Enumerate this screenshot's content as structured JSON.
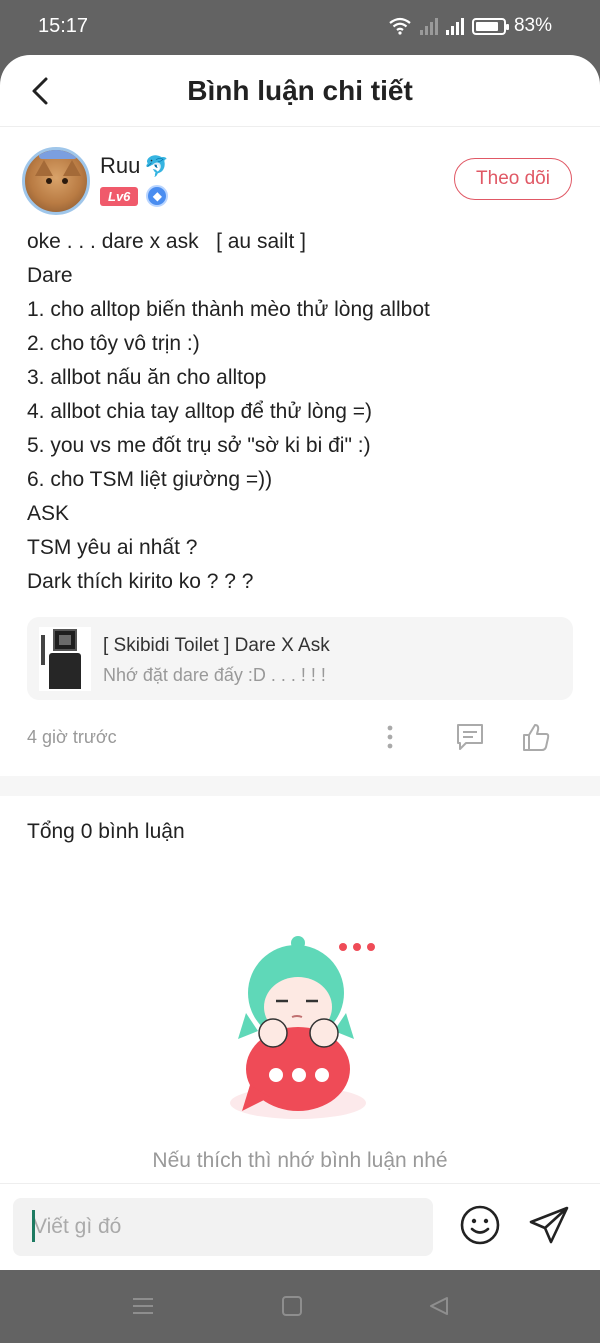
{
  "status_bar": {
    "time": "15:17",
    "battery": "83%",
    "battery_level": 0.83
  },
  "header": {
    "title": "Bình luận chi tiết"
  },
  "post": {
    "author": {
      "name": "Ruu",
      "badge_icon": "dolphin-icon",
      "level": "Lv6"
    },
    "follow_label": "Theo dõi",
    "content_lines": [
      "oke . . . dare x ask   [ au sailt ]",
      "Dare",
      "1. cho alltop biến thành mèo thử lòng allbot",
      "2. cho tôy vô trịn :)",
      "3. allbot nấu ăn cho alltop",
      "4. allbot chia tay alltop để thử lòng =)",
      "5. you vs me đốt trụ sở \"sờ ki bi đi\" :)",
      "6. cho TSM liệt giường =))",
      "ASK",
      "TSM yêu ai nhất ?",
      "Dark thích kirito ko ? ? ?"
    ],
    "reference": {
      "title": "[ Skibidi Toilet ] Dare X Ask",
      "subtitle": "Nhớ đặt dare đấy :D . . . ! ! !"
    },
    "timestamp": "4 giờ trước"
  },
  "comments": {
    "count_label": "Tổng 0 bình luận",
    "empty_text": "Nếu thích thì nhớ bình luận nhé"
  },
  "input": {
    "placeholder": "Viết gì đó"
  },
  "colors": {
    "accent": "#e05865",
    "level_badge": "#f05a6b",
    "verified": "#4a8df0",
    "mascot_hair": "#5fd8b8",
    "mascot_bubble": "#ef4b57"
  }
}
